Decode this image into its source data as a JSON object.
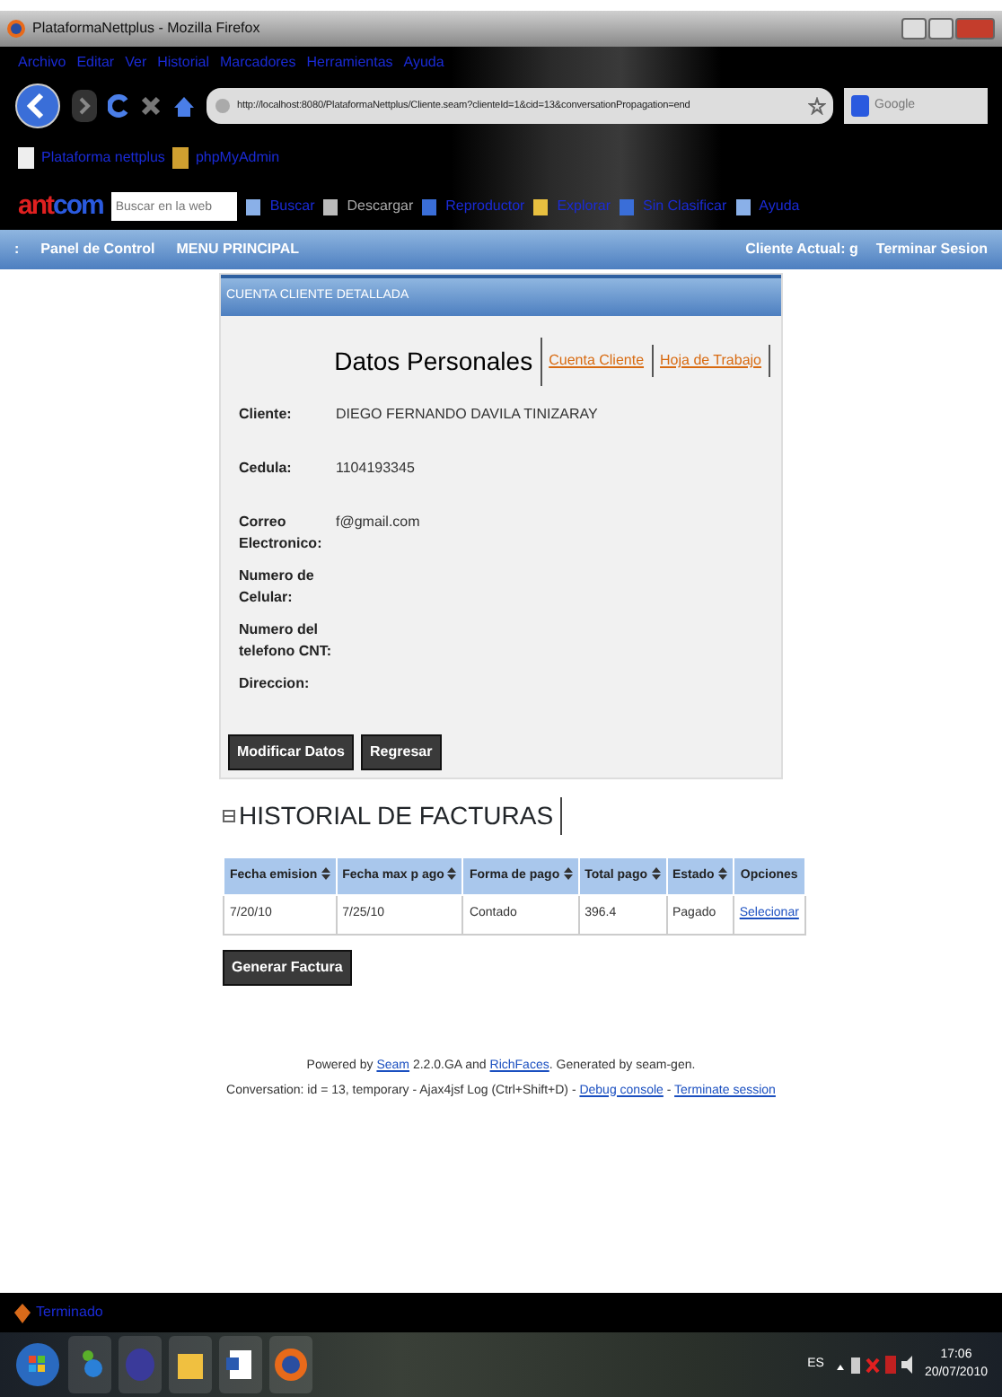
{
  "window": {
    "title": "PlataformaNettplus - Mozilla Firefox"
  },
  "menu": [
    "Archivo",
    "Editar",
    "Ver",
    "Historial",
    "Marcadores",
    "Herramientas",
    "Ayuda"
  ],
  "address_bar": {
    "url": "http://localhost:8080/PlataformaNettplus/Cliente.seam?clienteId=1&cid=13&conversationPropagation=end"
  },
  "search_box": {
    "placeholder": "Google"
  },
  "bookmarks": [
    "Plataforma nettplus",
    "phpMyAdmin"
  ],
  "ant_toolbar": {
    "logo": [
      "ant",
      "com"
    ],
    "search": {
      "placeholder": "Buscar en la web"
    },
    "buttons": [
      "Buscar",
      "Descargar",
      "Reproductor",
      "Explorar",
      "Sin Clasificar",
      "Ayuda"
    ]
  },
  "app_nav": {
    "left": [
      ":",
      "Panel de Control",
      "MENU PRINCIPAL"
    ],
    "right": [
      "Cliente Actual: g",
      "Terminar Sesion"
    ]
  },
  "panel": {
    "title": "CUENTA CLIENTE DETALLADA",
    "tabs": [
      {
        "label": "Datos Personales",
        "selected": true
      },
      {
        "label": "Cuenta Cliente",
        "selected": false
      },
      {
        "label": "Hoja de Trabajo",
        "selected": false
      }
    ],
    "fields": [
      {
        "label": "Cliente:",
        "value": "DIEGO FERNANDO DAVILA TINIZARAY"
      },
      {
        "label": "Cedula:",
        "value": "1104193345"
      },
      {
        "label": "Correo Electronico:",
        "value": "f@gmail.com"
      },
      {
        "label": "Numero de Celular:"
      },
      {
        "label": "Numero del telefono CNT:"
      },
      {
        "label": "Direccion:"
      }
    ],
    "buttons": [
      "Modificar Datos",
      "Regresar"
    ]
  },
  "history": {
    "title": "HISTORIAL DE FACTURAS",
    "expanded": true,
    "columns": [
      {
        "label": "Fecha emision",
        "sortable": true
      },
      {
        "label": "Fecha max p ago",
        "sortable": true
      },
      {
        "label": "Forma de pago",
        "sortable": true
      },
      {
        "label": "Total pago",
        "sortable": true
      },
      {
        "label": "Estado",
        "sortable": true
      },
      {
        "label": "Opciones",
        "sortable": false
      }
    ],
    "rows": [
      {
        "cells": [
          "7/20/10",
          "7/25/10",
          "Contado",
          "396.4",
          "Pagado"
        ],
        "action": "Selecionar"
      }
    ],
    "button": "Generar Factura"
  },
  "footer": [
    [
      {
        "kind": "text",
        "text": "Powered by "
      },
      {
        "kind": "link",
        "text": "Seam"
      },
      {
        "kind": "text",
        "text": " 2.2.0.GA and "
      },
      {
        "kind": "link",
        "text": "RichFaces"
      },
      {
        "kind": "text",
        "text": ". Generated by seam-gen."
      }
    ],
    [
      {
        "kind": "text",
        "text": "Conversation: id = 13, temporary - Ajax4jsf Log (Ctrl+Shift+D) - "
      },
      {
        "kind": "link",
        "text": "Debug console"
      },
      {
        "kind": "text",
        "text": " - "
      },
      {
        "kind": "link",
        "text": "Terminate session"
      }
    ]
  ],
  "status_bar": {
    "text": "Terminado"
  },
  "taskbar": {
    "language": "ES",
    "time": "17:06",
    "date": "20/07/2010"
  }
}
